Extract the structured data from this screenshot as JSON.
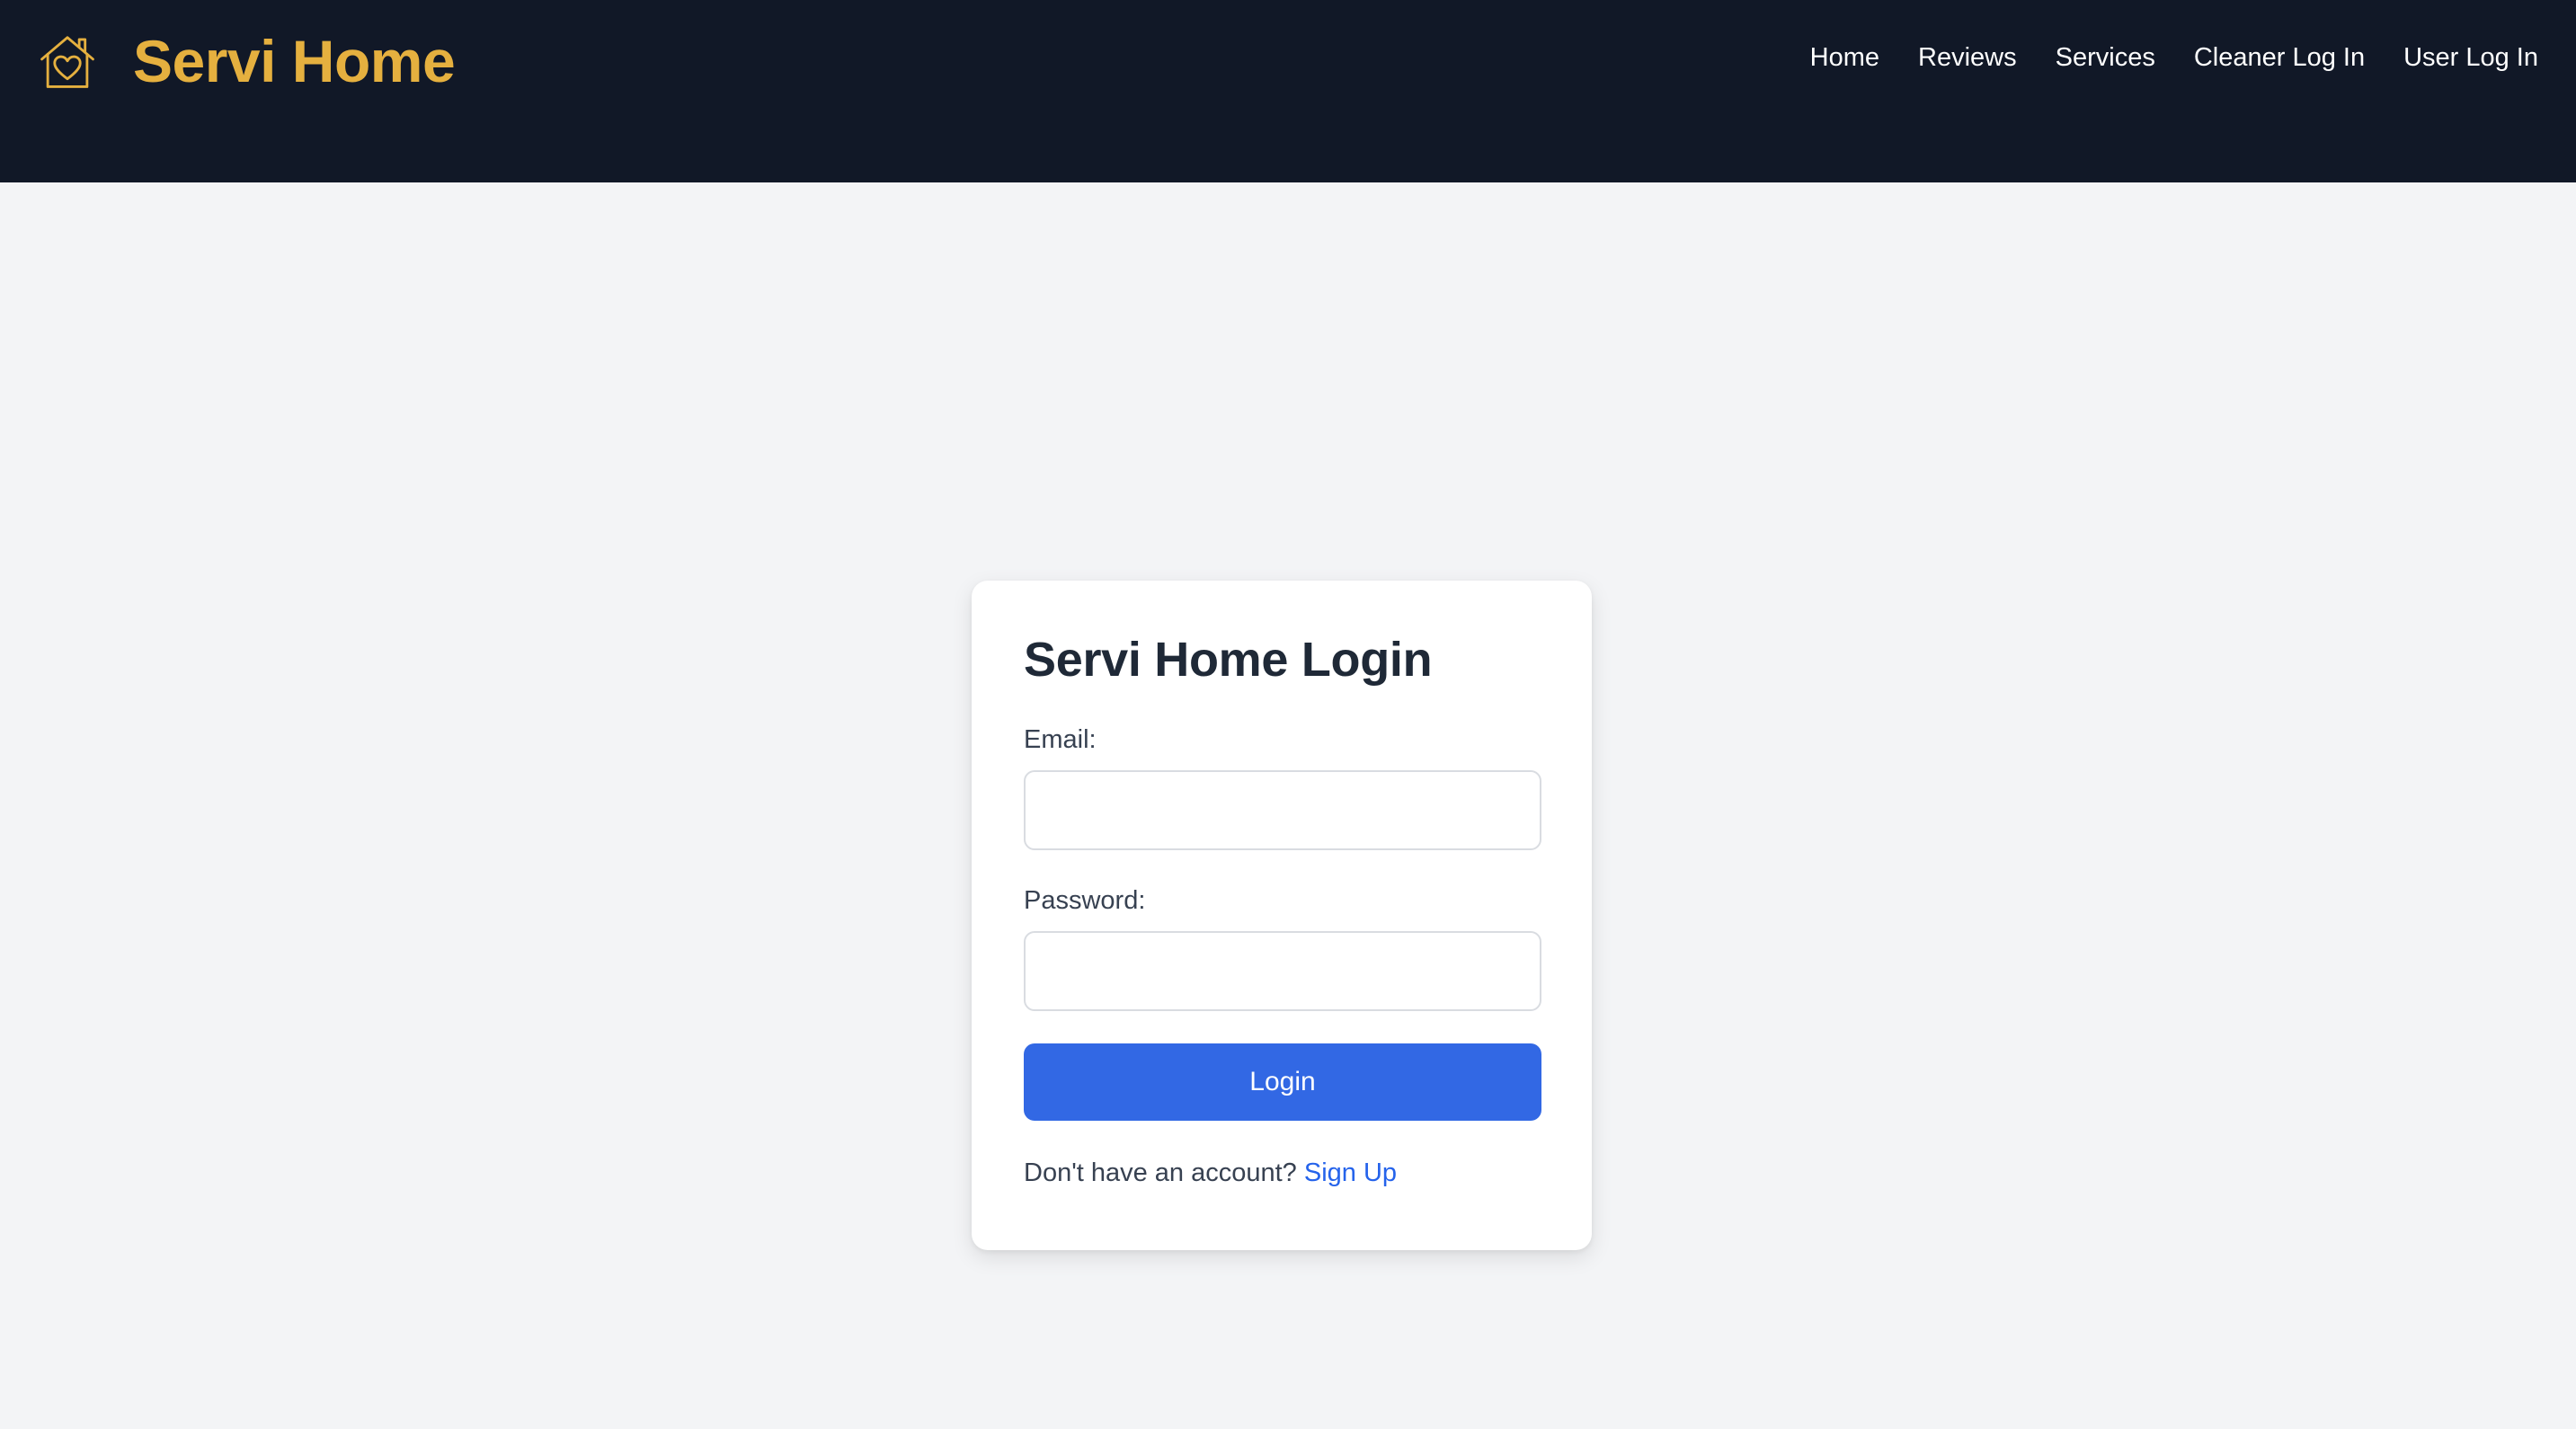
{
  "header": {
    "brand_name": "Servi Home",
    "logo_icon": "house-heart-icon",
    "nav": [
      {
        "label": "Home"
      },
      {
        "label": "Reviews"
      },
      {
        "label": "Services"
      },
      {
        "label": "Cleaner Log In"
      },
      {
        "label": "User Log In"
      }
    ]
  },
  "login": {
    "title": "Servi Home Login",
    "email_label": "Email:",
    "email_value": "",
    "password_label": "Password:",
    "password_value": "",
    "submit_label": "Login",
    "signup_prompt": "Don't have an account?",
    "signup_link": "Sign Up"
  },
  "colors": {
    "header_bg": "#111827",
    "brand": "#e5b03f",
    "page_bg": "#f3f4f6",
    "button": "#3268e4",
    "link": "#2563eb"
  }
}
